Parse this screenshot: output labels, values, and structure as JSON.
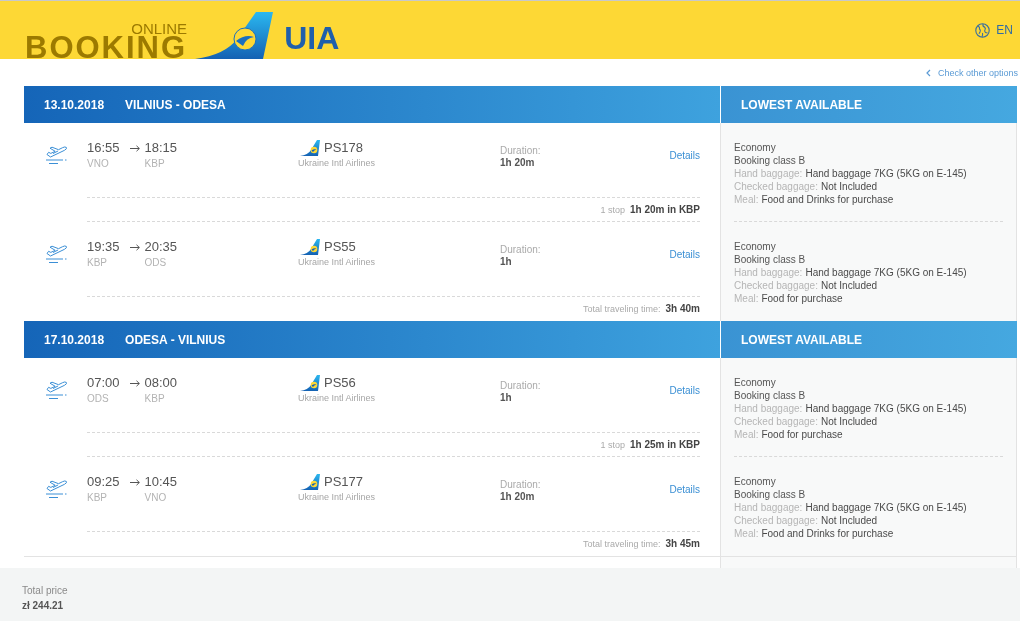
{
  "header": {
    "logo_top": "ONLINE",
    "logo_main": "BOOKING",
    "brand": "UIA",
    "language": "EN"
  },
  "options_link": "Check other options",
  "segments": [
    {
      "date": "13.10.2018",
      "route": "VILNIUS - ODESA",
      "fare_heading": "LOWEST AVAILABLE",
      "flights": [
        {
          "departure": "16:55",
          "arrival": "18:15",
          "from": "VNO",
          "to": "KBP",
          "flight_number": "PS178",
          "airline": "Ukraine Intl Airlines",
          "duration_label": "Duration:",
          "duration": "1h 20m",
          "details_link": "Details",
          "note": {
            "kind": "stop",
            "label": "1 stop",
            "value": "1h 20m in KBP"
          },
          "fare": {
            "cabin": "Economy",
            "booking_class": "Booking class B",
            "lines": [
              {
                "label": "Hand baggage:",
                "value": "Hand baggage 7KG (5KG on E-145)"
              },
              {
                "label": "Checked baggage:",
                "value": "Not Included"
              },
              {
                "label": "Meal:",
                "value": "Food and Drinks for purchase"
              }
            ]
          }
        },
        {
          "departure": "19:35",
          "arrival": "20:35",
          "from": "KBP",
          "to": "ODS",
          "flight_number": "PS55",
          "airline": "Ukraine Intl Airlines",
          "duration_label": "Duration:",
          "duration": "1h",
          "details_link": "Details",
          "note": {
            "kind": "total",
            "label": "Total traveling time:",
            "value": "3h 40m"
          },
          "fare": {
            "cabin": "Economy",
            "booking_class": "Booking class B",
            "lines": [
              {
                "label": "Hand baggage:",
                "value": "Hand baggage 7KG (5KG on E-145)"
              },
              {
                "label": "Checked baggage:",
                "value": "Not Included"
              },
              {
                "label": "Meal:",
                "value": "Food for purchase"
              }
            ]
          }
        }
      ]
    },
    {
      "date": "17.10.2018",
      "route": "ODESA - VILNIUS",
      "fare_heading": "LOWEST AVAILABLE",
      "flights": [
        {
          "departure": "07:00",
          "arrival": "08:00",
          "from": "ODS",
          "to": "KBP",
          "flight_number": "PS56",
          "airline": "Ukraine Intl Airlines",
          "duration_label": "Duration:",
          "duration": "1h",
          "details_link": "Details",
          "note": {
            "kind": "stop",
            "label": "1 stop",
            "value": "1h 25m in KBP"
          },
          "fare": {
            "cabin": "Economy",
            "booking_class": "Booking class B",
            "lines": [
              {
                "label": "Hand baggage:",
                "value": "Hand baggage 7KG (5KG on E-145)"
              },
              {
                "label": "Checked baggage:",
                "value": "Not Included"
              },
              {
                "label": "Meal:",
                "value": "Food for purchase"
              }
            ]
          }
        },
        {
          "departure": "09:25",
          "arrival": "10:45",
          "from": "KBP",
          "to": "VNO",
          "flight_number": "PS177",
          "airline": "Ukraine Intl Airlines",
          "duration_label": "Duration:",
          "duration": "1h 20m",
          "details_link": "Details",
          "note": {
            "kind": "total",
            "label": "Total traveling time:",
            "value": "3h 45m"
          },
          "fare": {
            "cabin": "Economy",
            "booking_class": "Booking class B",
            "lines": [
              {
                "label": "Hand baggage:",
                "value": "Hand baggage 7KG (5KG on E-145)"
              },
              {
                "label": "Checked baggage:",
                "value": "Not Included"
              },
              {
                "label": "Meal:",
                "value": "Food and Drinks for purchase"
              }
            ]
          }
        }
      ]
    }
  ],
  "total": {
    "label": "Total price",
    "value": "zł 244.21"
  }
}
